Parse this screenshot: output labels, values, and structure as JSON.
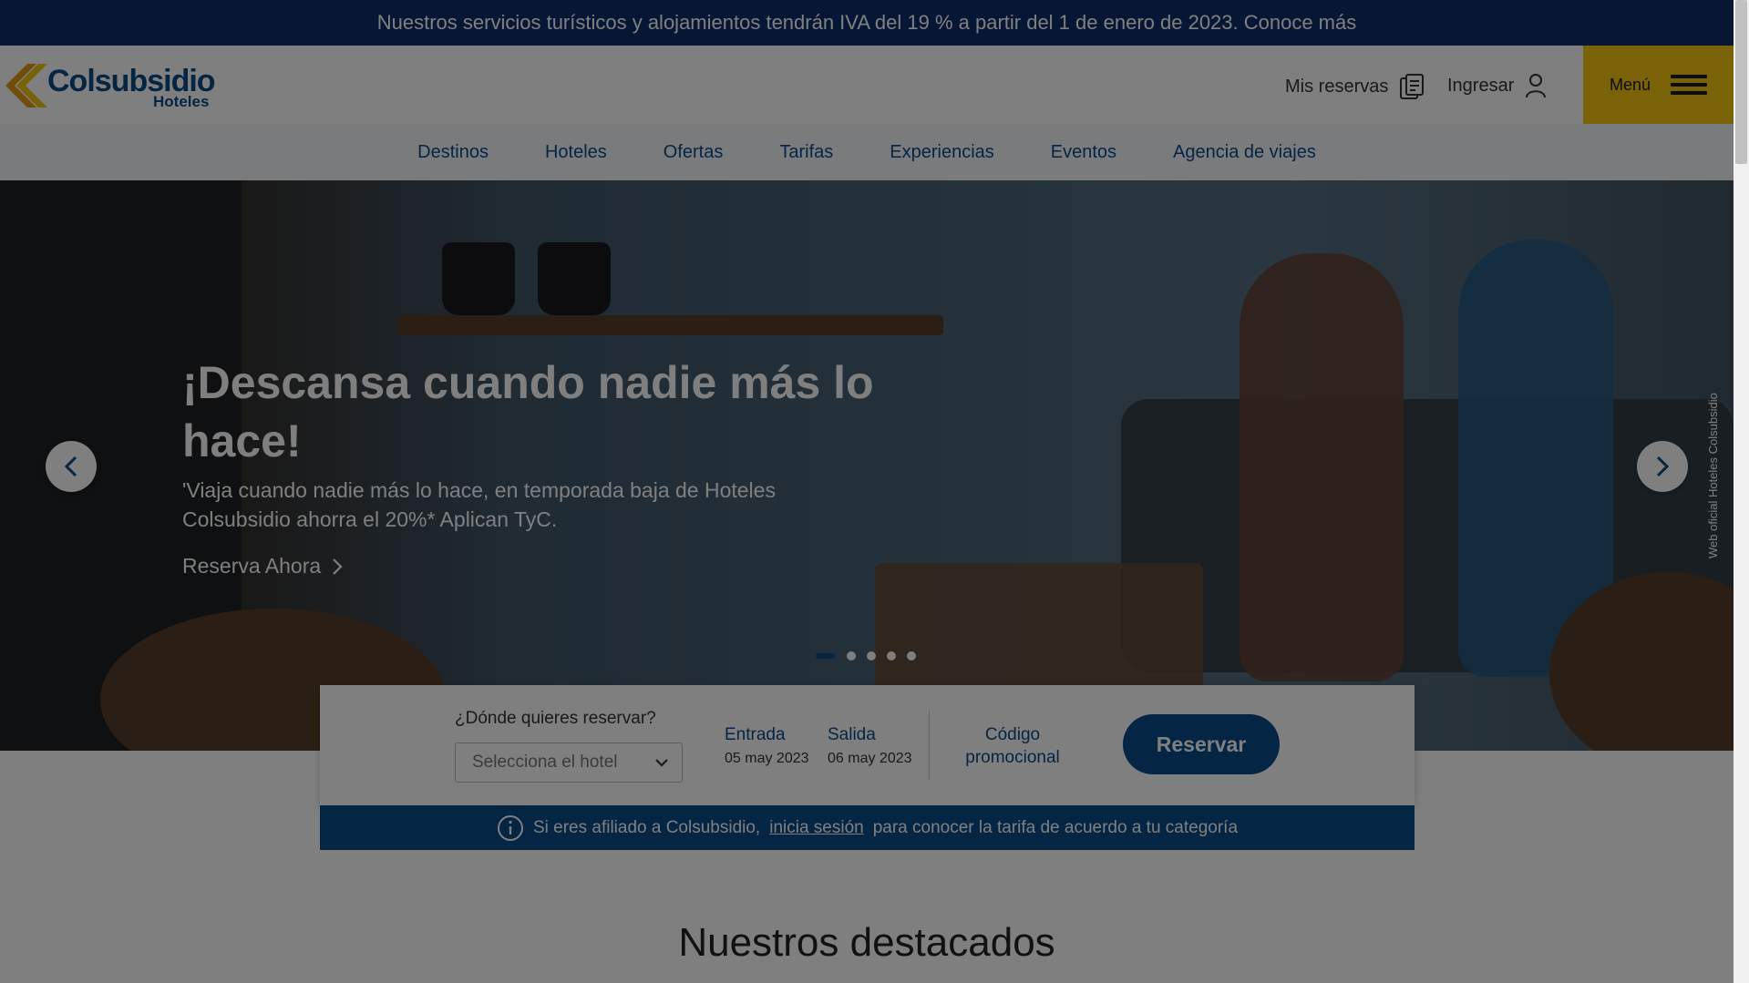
{
  "announcement": "Nuestros servicios turísticos y alojamientos tendrán IVA del 19 % a partir del 1 de enero de 2023. Conoce más",
  "header": {
    "logo_name": "Colsubsidio",
    "logo_sub": "Hoteles",
    "reservations": "Mis reservas",
    "login": "Ingresar",
    "menu": "Menú"
  },
  "nav": [
    "Destinos",
    "Hoteles",
    "Ofertas",
    "Tarifas",
    "Experiencias",
    "Eventos",
    "Agencia de viajes"
  ],
  "hero": {
    "title": "¡Descansa cuando nadie más lo hace!",
    "subtitle": "'Viaja cuando nadie más lo hace, en temporada baja de Hoteles Colsubsidio ahorra el 20%* Aplican TyC.",
    "cta": "Reserva Ahora",
    "vertical_text": "Web oficial  Hoteles Colsubsidio",
    "slides": 5,
    "active_slide": 1
  },
  "booking": {
    "where_label": "¿Dónde quieres reservar?",
    "hotel_placeholder": "Selecciona el hotel",
    "checkin_label": "Entrada",
    "checkin_value": "05  may 2023",
    "checkout_label": "Salida",
    "checkout_value": "06  may 2023",
    "promo_line1": "Código",
    "promo_line2": "promocional",
    "button": "Reservar"
  },
  "info": {
    "prefix": "Si eres afiliado a Colsubsidio,",
    "link": "inicia sesión",
    "suffix": "para conocer la tarifa de acuerdo a tu categoría"
  },
  "section_title": "Nuestros destacados",
  "colors": {
    "primary": "#0a4a8a",
    "announce": "#0a2f6b",
    "accent": "#f2c40f"
  }
}
